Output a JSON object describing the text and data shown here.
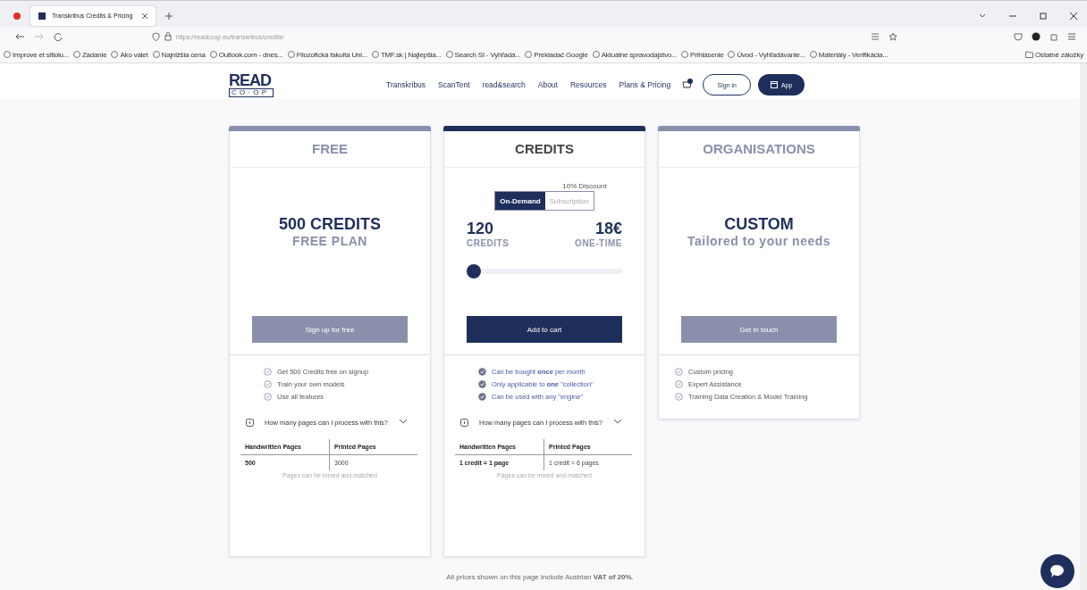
{
  "browser": {
    "tab_title": "Transkribus Credits & Pricing",
    "url": "https://readcoop.eu/transkribus/credits/",
    "bookmarks": [
      "Improve et sitiolu...",
      "Zadanie",
      "Ako valet",
      "Najnižšia cena",
      "Outlook.com - dnes...",
      "Filozofická fakulta Uni...",
      "TMF.sk | Najlepšia...",
      "Search SI - Vyhľadá...",
      "Prekladač Google",
      "Aktuálne spravodajstvo...",
      "Prihlásenie",
      "Úvod - Vyhľadávanie...",
      "Materiály - Verifikácia..."
    ],
    "other_bookmarks": "Ostatné záložky"
  },
  "nav": {
    "logo_top": "READ",
    "logo_bottom": "C O · O P",
    "links": [
      "Transkribus",
      "ScanTent",
      "read&search",
      "About",
      "Resources",
      "Plans & Pricing"
    ],
    "sign_in": "Sign in",
    "app": "App"
  },
  "plans": [
    {
      "kind": "static",
      "title": "FREE",
      "featured": false,
      "headline": "500 CREDITS",
      "subline": "FREE PLAN",
      "button": "Sign up for free",
      "features": [
        "Get 500 Credits free on signup",
        "Train your own models",
        "Use all features"
      ],
      "faq": "How many pages can I process with this?",
      "table": {
        "columns": [
          "Handwritten Pages",
          "Printed Pages"
        ],
        "row": [
          "500",
          "3000"
        ]
      },
      "note": "Pages can be mixed and matched"
    },
    {
      "kind": "calculator",
      "title": "CREDITS",
      "featured": true,
      "discount": "10% Discount",
      "modes": [
        {
          "label": "On-Demand",
          "selected": true
        },
        {
          "label": "Subscription",
          "selected": false
        }
      ],
      "amount": "120",
      "amount_label": "CREDITS",
      "price": "18€",
      "price_label": "ONE-TIME",
      "slider": {
        "level": 0.0
      },
      "button": "Add to cart",
      "features": [
        "Can be bought **once** per month",
        "Only applicable to **one** \"collection\"",
        "Can be used with any \"engine\""
      ],
      "faq": "How many pages can I process with this?",
      "table": {
        "columns": [
          "Handwritten Pages",
          "Printed Pages"
        ],
        "row": [
          "1 credit = 1 page",
          "1 credit = 6 pages"
        ]
      },
      "note": "Pages can be mixed and matched"
    },
    {
      "kind": "static",
      "title": "ORGANISATIONS",
      "featured": false,
      "headline": "CUSTOM",
      "subline": "Tailored to your needs",
      "button": "Get in touch",
      "features": [
        "Custom pricing",
        "Expert Assistance",
        "Training Data Creation & Model Training"
      ]
    }
  ],
  "footer_note": "All prices shown on this page include Austrian **VAT of 20%**."
}
